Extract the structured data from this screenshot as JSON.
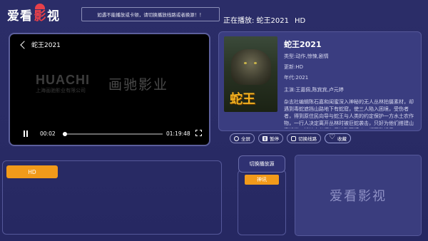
{
  "header": {
    "logo_left": "爱看",
    "logo_mid": "影",
    "logo_right": "视",
    "notice": "如遇不能播放或卡顿，请切换播放线路或者换源！！",
    "now_playing_label": "正在播放: 蛇王2021",
    "now_playing_quality": "HD"
  },
  "player": {
    "title": "蛇王2021",
    "watermark_brand": "HUACHI",
    "watermark_company": "上海画驰影业有限公司",
    "watermark_calligraphy": "画驰影业",
    "current_time": "00:02",
    "total_time": "01:19:48",
    "progress": 0.02
  },
  "info": {
    "title": "蛇王2021",
    "poster_title": "蛇王",
    "poster_subtitle": "",
    "rows": [
      {
        "label": "类型:",
        "value": "动作,惊悚,剧情"
      },
      {
        "label": "更新:",
        "value": "HD"
      },
      {
        "label": "年代:",
        "value": "2021"
      },
      {
        "label": "主演:",
        "value": "王嘉佩,陈宾宾,卢元婷"
      }
    ],
    "synopsis": "杂志社编辑陈石嘉和闺蜜深入神秘的无人丛林拍摄素材，却遇到毒蛇遮挡山路地下有蛇窟，使三人陷入困境，受伤者者，得到原住民向导与蛇王与人类的约定保护一方水土农作物，一行人决定离开丛林时被巨蛇袭击，只好为他们搭建山寨躲避，捕蛇人必须与巨蛇殊死搏斗，都不敢轻易……"
  },
  "actions": {
    "fullscreen": "全屏",
    "pause": "暂停",
    "switch_route": "切换线路",
    "favorite": "收藏"
  },
  "episodes": {
    "items": [
      "HD"
    ]
  },
  "source": {
    "switch_label": "切换播放源",
    "current": "神讯"
  },
  "ad": {
    "text": "爱看影视"
  }
}
